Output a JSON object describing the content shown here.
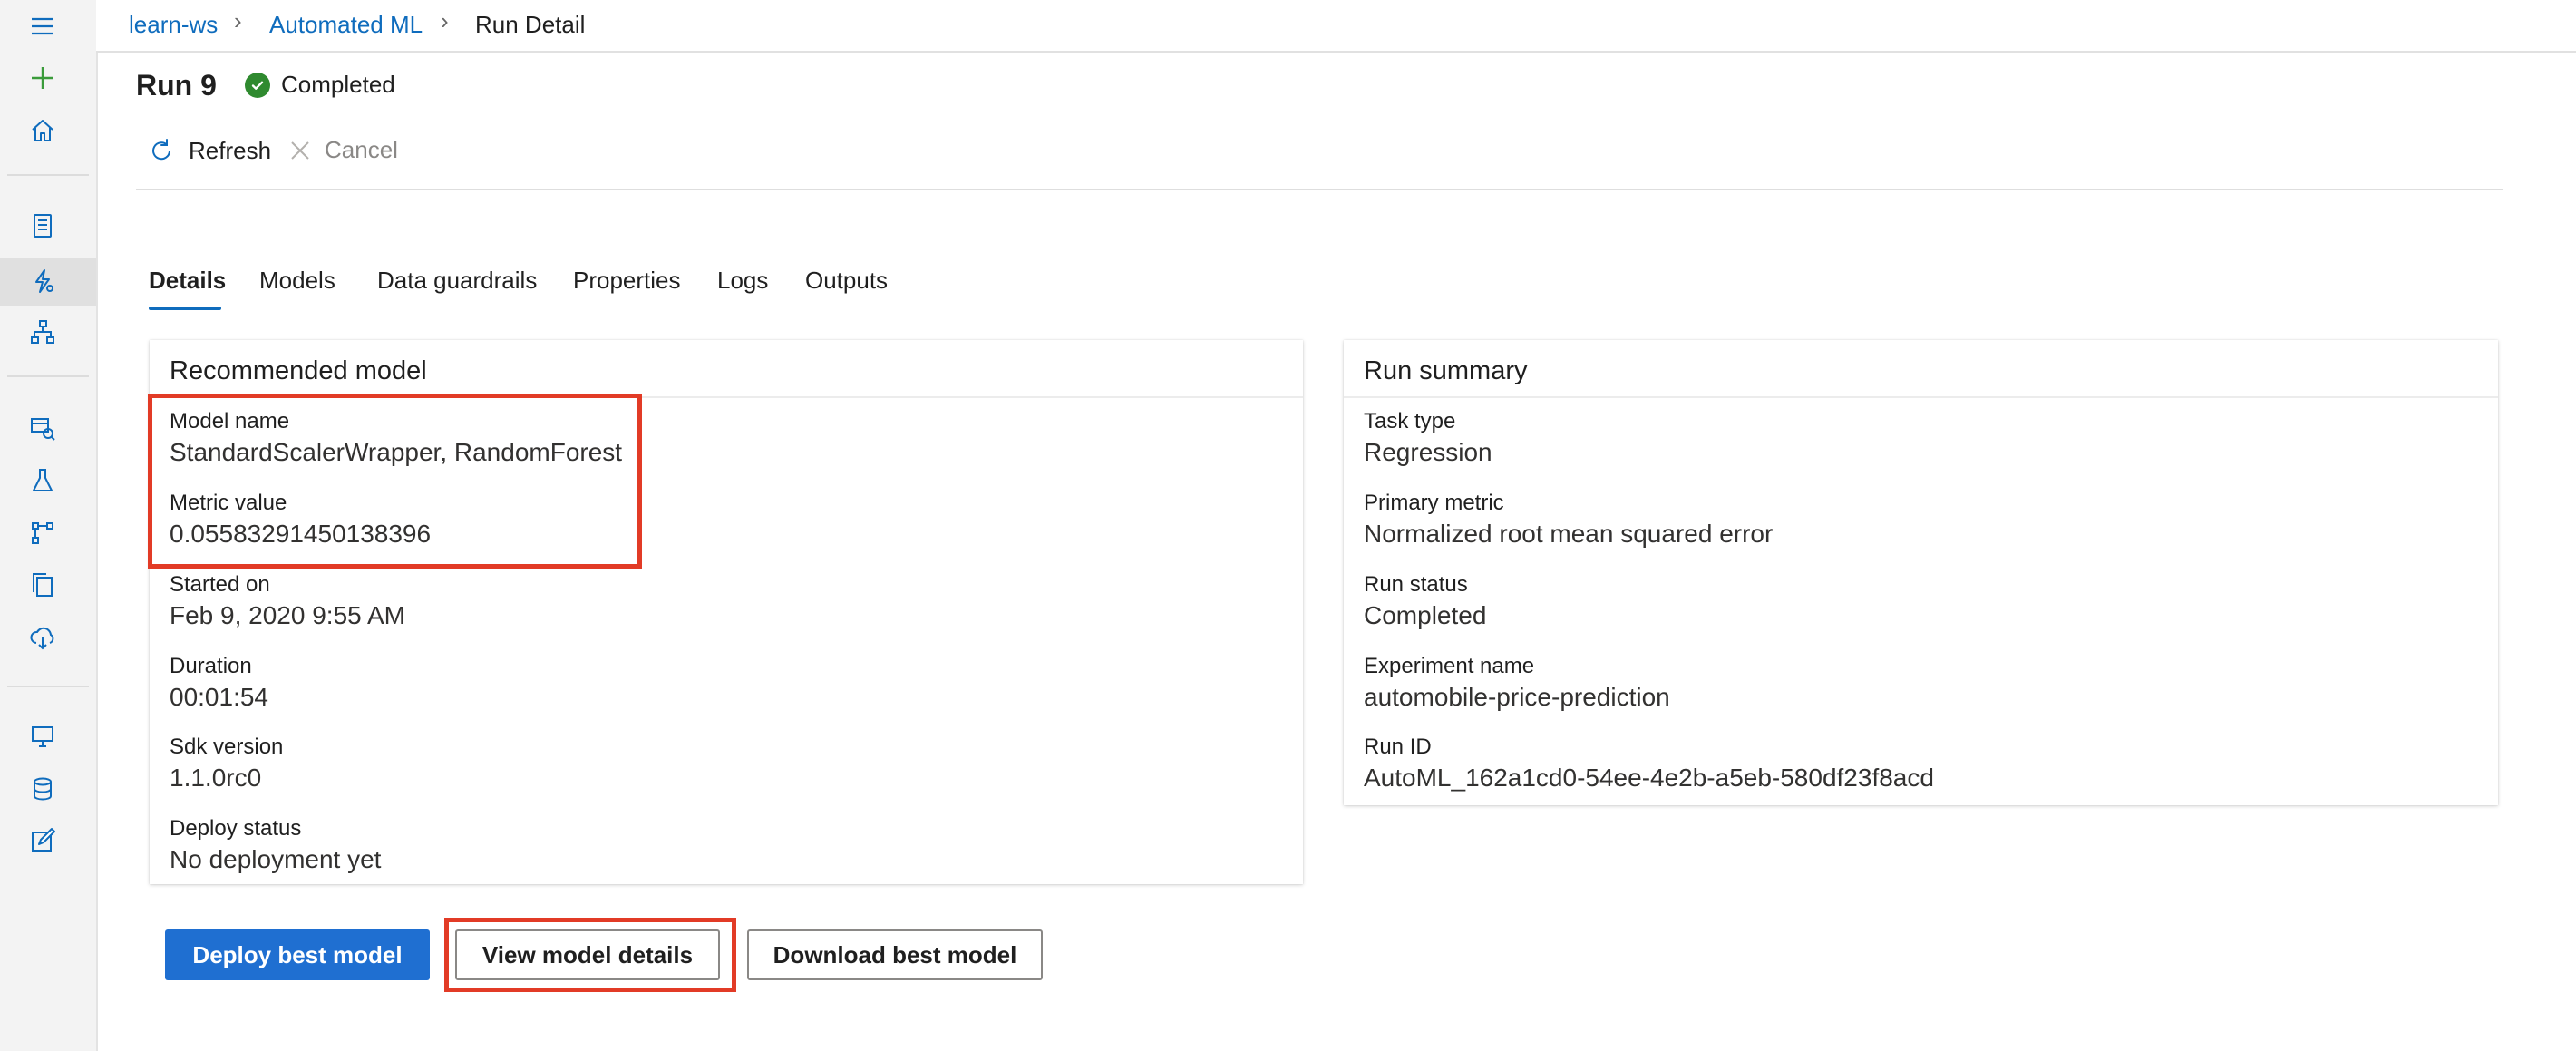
{
  "breadcrumb": {
    "workspace": "learn-ws",
    "section": "Automated ML",
    "current": "Run Detail"
  },
  "header": {
    "title": "Run 9",
    "status": "Completed"
  },
  "commands": {
    "refresh": "Refresh",
    "cancel": "Cancel"
  },
  "tabs": [
    {
      "label": "Details",
      "active": true
    },
    {
      "label": "Models"
    },
    {
      "label": "Data guardrails"
    },
    {
      "label": "Properties"
    },
    {
      "label": "Logs"
    },
    {
      "label": "Outputs"
    }
  ],
  "recommended": {
    "title": "Recommended model",
    "fields": [
      {
        "label": "Model name",
        "value": "StandardScalerWrapper, RandomForest"
      },
      {
        "label": "Metric value",
        "value": "0.05583291450138396"
      },
      {
        "label": "Started on",
        "value": "Feb 9, 2020 9:55 AM"
      },
      {
        "label": "Duration",
        "value": "00:01:54"
      },
      {
        "label": "Sdk version",
        "value": "1.1.0rc0"
      },
      {
        "label": "Deploy status",
        "value": "No deployment yet"
      }
    ]
  },
  "summary": {
    "title": "Run summary",
    "fields": [
      {
        "label": "Task type",
        "value": "Regression"
      },
      {
        "label": "Primary metric",
        "value": "Normalized root mean squared error"
      },
      {
        "label": "Run status",
        "value": "Completed"
      },
      {
        "label": "Experiment name",
        "value": "automobile-price-prediction"
      },
      {
        "label": "Run ID",
        "value": "AutoML_162a1cd0-54ee-4e2b-a5eb-580df23f8acd"
      }
    ]
  },
  "actions": {
    "deploy": "Deploy best model",
    "view": "View model details",
    "download": "Download best model"
  },
  "colors": {
    "accent": "#1f6fd1",
    "link": "#0f6cbd",
    "success": "#2f8a2f",
    "highlight": "#e23b26"
  }
}
